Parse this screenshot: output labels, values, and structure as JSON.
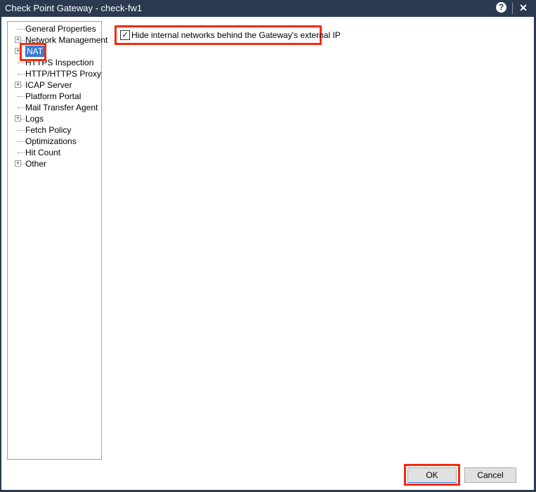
{
  "window": {
    "title": "Check Point Gateway - check-fw1",
    "help": "?",
    "close": "✕"
  },
  "tree": [
    {
      "label": "General Properties",
      "expandable": false,
      "selected": false
    },
    {
      "label": "Network Management",
      "expandable": true,
      "selected": false
    },
    {
      "label": "NAT",
      "expandable": true,
      "selected": true
    },
    {
      "label": "HTTPS Inspection",
      "expandable": false,
      "selected": false
    },
    {
      "label": "HTTP/HTTPS Proxy",
      "expandable": false,
      "selected": false
    },
    {
      "label": "ICAP Server",
      "expandable": true,
      "selected": false
    },
    {
      "label": "Platform Portal",
      "expandable": false,
      "selected": false
    },
    {
      "label": "Mail Transfer Agent",
      "expandable": false,
      "selected": false
    },
    {
      "label": "Logs",
      "expandable": true,
      "selected": false
    },
    {
      "label": "Fetch Policy",
      "expandable": false,
      "selected": false
    },
    {
      "label": "Optimizations",
      "expandable": false,
      "selected": false
    },
    {
      "label": "Hit Count",
      "expandable": false,
      "selected": false
    },
    {
      "label": "Other",
      "expandable": true,
      "selected": false
    }
  ],
  "nat": {
    "hide_internal_label": "Hide internal networks behind the Gateway's external IP",
    "hide_internal_checked": true,
    "check_glyph": "✓"
  },
  "buttons": {
    "ok": "OK",
    "cancel": "Cancel"
  },
  "colors": {
    "highlight": "#f52a0a",
    "selection": "#3a7bd5",
    "titlebar": "#2b3a50"
  }
}
